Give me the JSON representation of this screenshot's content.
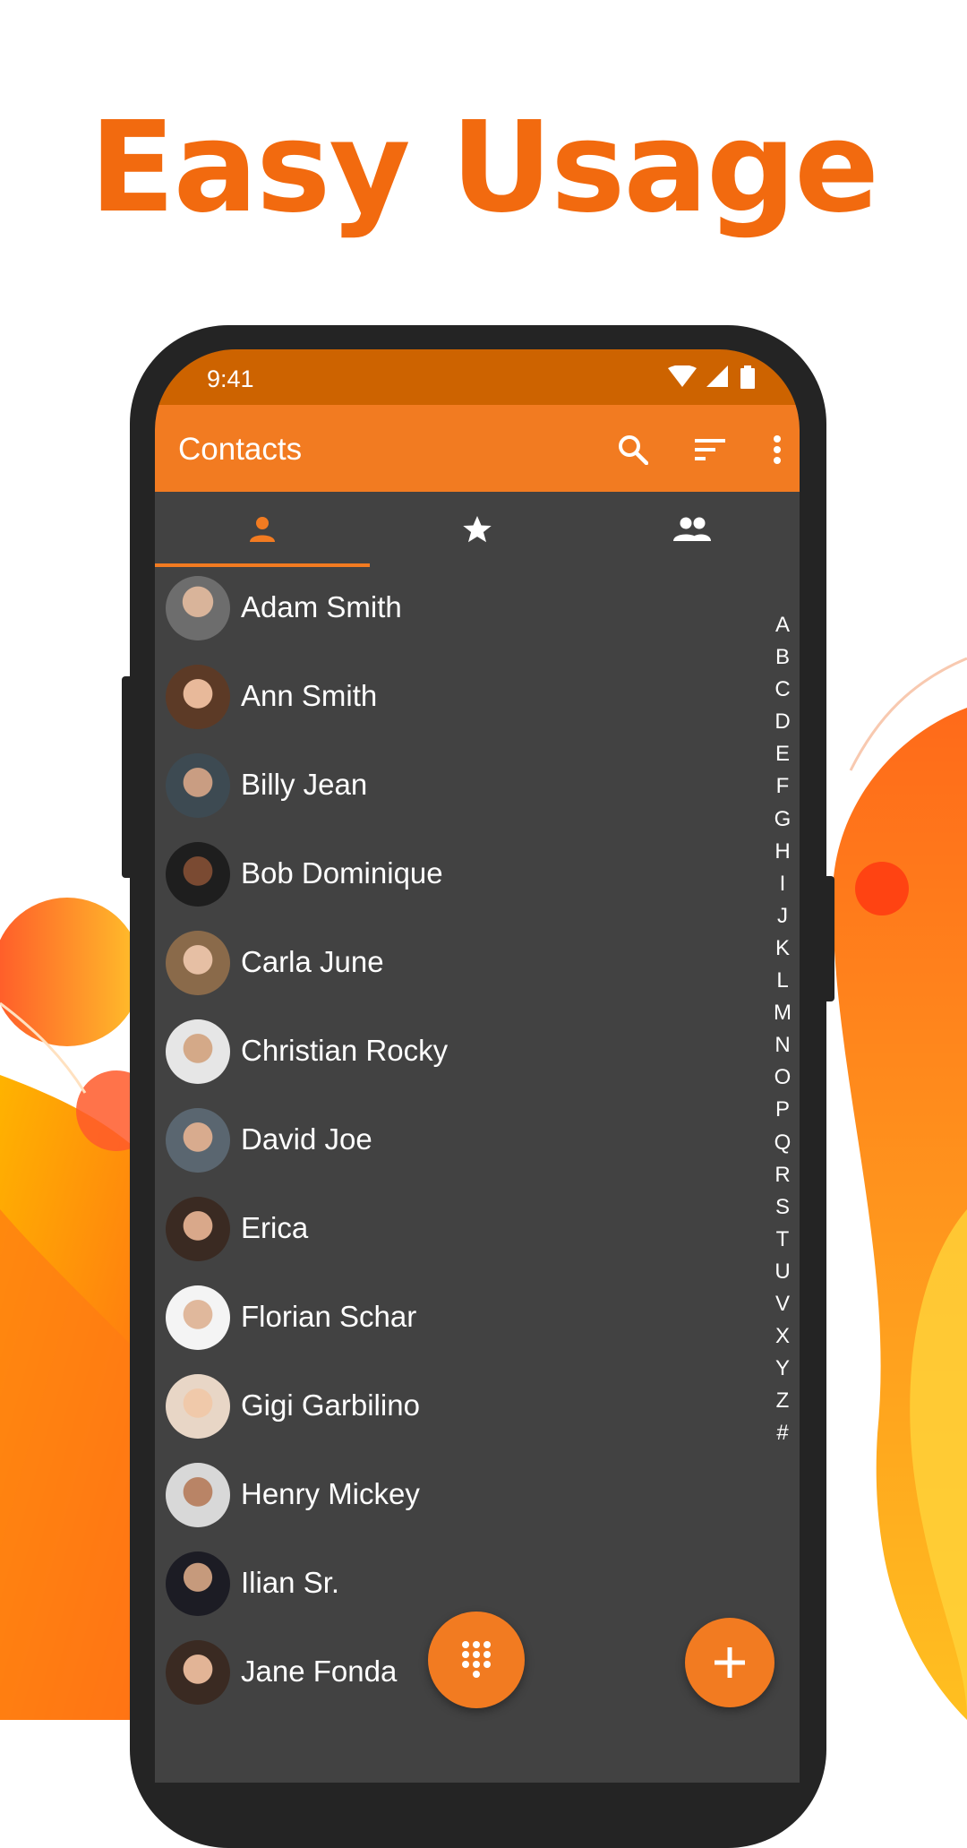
{
  "headline": "Easy Usage",
  "status_bar": {
    "time": "9:41"
  },
  "app_bar": {
    "title": "Contacts"
  },
  "tabs": [
    {
      "name": "contacts",
      "icon": "person-icon",
      "active": true
    },
    {
      "name": "favorites",
      "icon": "star-icon",
      "active": false
    },
    {
      "name": "groups",
      "icon": "group-icon",
      "active": false
    }
  ],
  "contacts": [
    {
      "name": "Adam Smith"
    },
    {
      "name": "Ann Smith"
    },
    {
      "name": "Billy Jean"
    },
    {
      "name": "Bob Dominique"
    },
    {
      "name": "Carla June"
    },
    {
      "name": "Christian Rocky"
    },
    {
      "name": "David Joe"
    },
    {
      "name": "Erica"
    },
    {
      "name": "Florian Schar"
    },
    {
      "name": "Gigi Garbilino"
    },
    {
      "name": "Henry Mickey"
    },
    {
      "name": "Ilian Sr."
    },
    {
      "name": "Jane Fonda"
    }
  ],
  "alphabet": [
    "A",
    "B",
    "C",
    "D",
    "E",
    "F",
    "G",
    "H",
    "I",
    "J",
    "K",
    "L",
    "M",
    "N",
    "O",
    "P",
    "Q",
    "R",
    "S",
    "T",
    "U",
    "V",
    "X",
    "Y",
    "Z",
    "#"
  ],
  "colors": {
    "accent": "#f27b21",
    "status_bar": "#cd6300",
    "background": "#424242",
    "headline": "#f26a0f"
  }
}
